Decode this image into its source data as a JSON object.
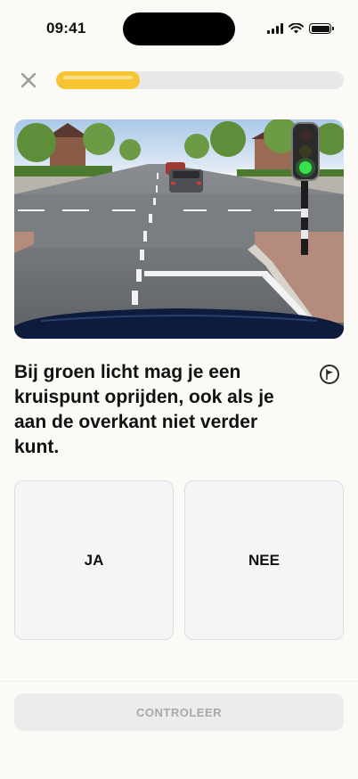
{
  "status_bar": {
    "time": "09:41"
  },
  "header": {
    "progress": 0.29
  },
  "question": {
    "text": "Bij groen licht mag je een kruispunt oprijden, ook als je aan de overkant niet verder kunt."
  },
  "answers": [
    {
      "label": "JA"
    },
    {
      "label": "NEE"
    }
  ],
  "footer": {
    "check_label": "CONTROLEER"
  },
  "colors": {
    "accent": "#f7c531",
    "background": "#fbfaf6",
    "card": "#f4f5f7",
    "disabled_text": "#a9a9a9"
  },
  "icons": [
    "close-icon",
    "flag-icon",
    "signal-icon",
    "wifi-icon",
    "battery-icon"
  ]
}
